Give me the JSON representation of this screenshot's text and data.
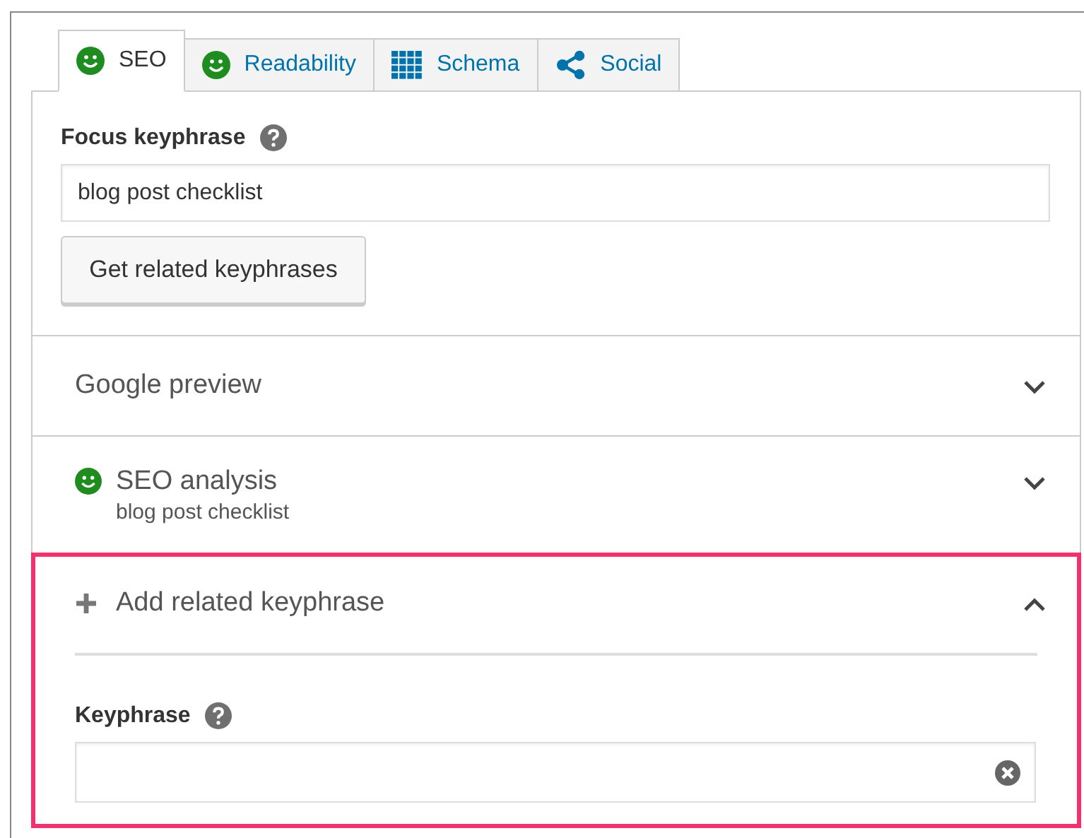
{
  "tabs": [
    {
      "label": "SEO",
      "kind": "smiley",
      "selected": true
    },
    {
      "label": "Readability",
      "kind": "smiley",
      "selected": false
    },
    {
      "label": "Schema",
      "kind": "grid",
      "selected": false
    },
    {
      "label": "Social",
      "kind": "share",
      "selected": false
    }
  ],
  "focus_keyphrase": {
    "label": "Focus keyphrase",
    "value": "blog post checklist",
    "button": "Get related keyphrases"
  },
  "sections": [
    {
      "title": "Google preview",
      "kind": "plain",
      "expanded": false,
      "highlighted": false
    },
    {
      "title": "SEO analysis",
      "subtitle": "blog post checklist",
      "kind": "smiley",
      "expanded": false,
      "highlighted": false
    },
    {
      "title": "Add related keyphrase",
      "kind": "plus",
      "expanded": true,
      "highlighted": true,
      "field": {
        "label": "Keyphrase"
      }
    }
  ]
}
